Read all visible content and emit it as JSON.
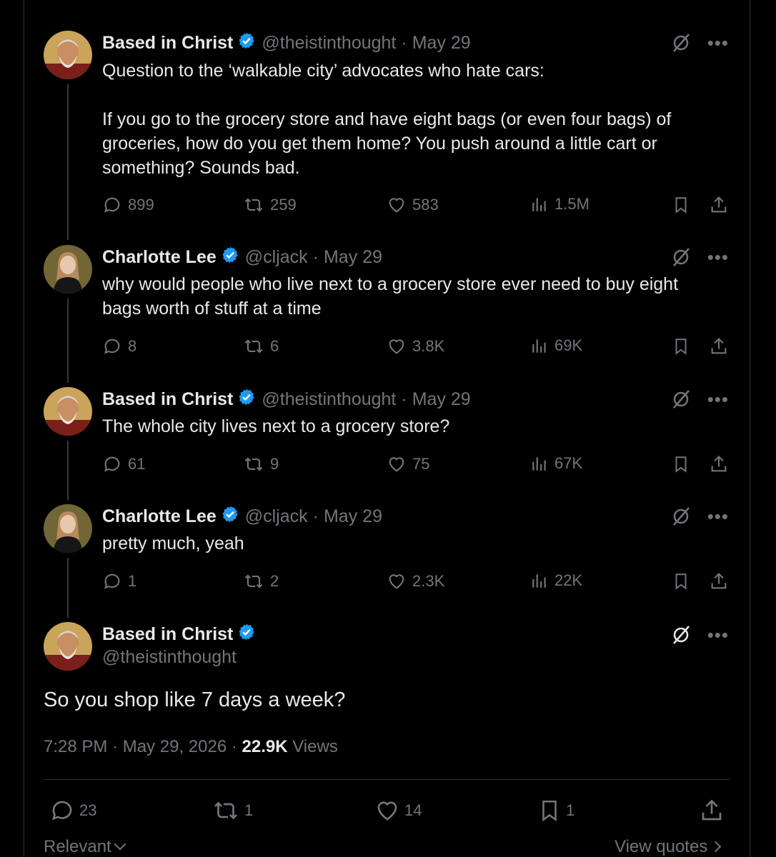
{
  "tweets": [
    {
      "name": "Based in Christ",
      "handle": "@theistinthought",
      "separator": "·",
      "date": "May 29",
      "text": "Question to the ‘walkable city’ advocates who hate cars:\n\nIf you go to the grocery store and have eight bags (or even four bags) of groceries, how do you get them home? You push around a little cart or something? Sounds bad.",
      "replies": "899",
      "reposts": "259",
      "likes": "583",
      "views": "1.5M"
    },
    {
      "name": "Charlotte Lee",
      "handle": "@cljack",
      "separator": "·",
      "date": "May 29",
      "text": "why would people who live next to a grocery store ever need to buy eight bags worth of stuff at a time",
      "replies": "8",
      "reposts": "6",
      "likes": "3.8K",
      "views": "69K"
    },
    {
      "name": "Based in Christ",
      "handle": "@theistinthought",
      "separator": "·",
      "date": "May 29",
      "text": "The whole city lives next to a grocery store?",
      "replies": "61",
      "reposts": "9",
      "likes": "75",
      "views": "67K"
    },
    {
      "name": "Charlotte Lee",
      "handle": "@cljack",
      "separator": "·",
      "date": "May 29",
      "text": "pretty much, yeah",
      "replies": "1",
      "reposts": "2",
      "likes": "2.3K",
      "views": "22K"
    }
  ],
  "main": {
    "name": "Based in Christ",
    "handle": "@theistinthought",
    "text": "So you shop like 7 days a week?",
    "time": "7:28 PM",
    "separator": "·",
    "date": "May 29, 2026",
    "views_count": "22.9K",
    "views_label": "Views",
    "replies": "23",
    "reposts": "1",
    "likes": "14",
    "bookmarks": "1"
  },
  "footer": {
    "sort_label": "Relevant",
    "view_quotes": "View quotes"
  },
  "colors": {
    "background": "#000000",
    "text": "#e7e9ea",
    "muted": "#71767b",
    "verified": "#1d9bf0",
    "border": "#2f3336"
  }
}
